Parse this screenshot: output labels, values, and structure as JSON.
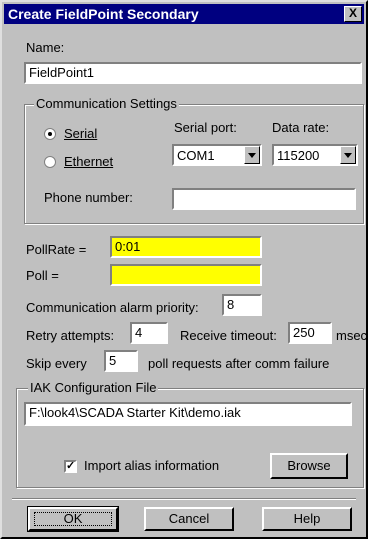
{
  "window": {
    "title": "Create FieldPoint Secondary",
    "close_glyph": "X"
  },
  "name_field": {
    "label": "Name:",
    "value": "FieldPoint1"
  },
  "comm_settings": {
    "legend": "Communication Settings",
    "serial_label": "Serial",
    "ethernet_label": "Ethernet",
    "selected": "Serial",
    "serial_port_label": "Serial port:",
    "serial_port_value": "COM1",
    "data_rate_label": "Data rate:",
    "data_rate_value": "115200",
    "phone_label": "Phone number:",
    "phone_value": ""
  },
  "poll": {
    "pollrate_label": "PollRate =",
    "pollrate_value": "0:01",
    "poll_label": "Poll =",
    "poll_value": ""
  },
  "alarm": {
    "label": "Communication alarm priority:",
    "value": "8"
  },
  "retry": {
    "label": "Retry attempts:",
    "value": "4",
    "timeout_label": "Receive timeout:",
    "timeout_value": "250",
    "units": "msecs"
  },
  "skip": {
    "label": "Skip every",
    "value": "5",
    "suffix": "poll requests after comm failure"
  },
  "iak": {
    "legend": "IAK Configuration File",
    "path": "F:\\look4\\SCADA Starter Kit\\demo.iak",
    "import_label": "Import alias information",
    "import_checked": true,
    "browse_label": "Browse"
  },
  "buttons": {
    "ok": "OK",
    "cancel": "Cancel",
    "help": "Help"
  },
  "colors": {
    "titlebar": "#000080",
    "highlight_field": "#ffff00",
    "dialog": "#c0c0c0"
  }
}
